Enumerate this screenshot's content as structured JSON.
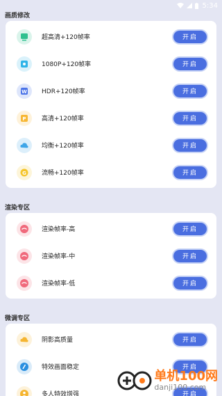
{
  "status_bar": {
    "time": "5:34"
  },
  "sections": [
    {
      "title": "画质修改",
      "items": [
        {
          "label": "超高清+120帧率",
          "button": "开启",
          "icon": "hd-monitor-icon",
          "color": "#2fc08f"
        },
        {
          "label": "1080P+120帧率",
          "button": "开启",
          "icon": "eye-icon",
          "color": "#2fb4e8"
        },
        {
          "label": "HDR+120帧率",
          "button": "开启",
          "icon": "w-letter-icon",
          "color": "#4a73e8"
        },
        {
          "label": "高清+120帧率",
          "button": "开启",
          "icon": "p-letter-icon",
          "color": "#f7b733"
        },
        {
          "label": "均衡+120帧率",
          "button": "开启",
          "icon": "cloud-icon",
          "color": "#3fa6e8"
        },
        {
          "label": "流畅+120帧率",
          "button": "开启",
          "icon": "g-letter-icon",
          "color": "#f5c52c"
        }
      ]
    },
    {
      "title": "渲染专区",
      "items": [
        {
          "label": "渲染帧率-高",
          "button": "开启",
          "icon": "render-icon",
          "color": "#f06a7c"
        },
        {
          "label": "渲染帧率-中",
          "button": "开启",
          "icon": "render-icon",
          "color": "#f06a7c"
        },
        {
          "label": "渲染帧率-低",
          "button": "开启",
          "icon": "render-icon",
          "color": "#f06a7c"
        }
      ]
    },
    {
      "title": "微调专区",
      "items": [
        {
          "label": "阴影高质量",
          "button": "开启",
          "icon": "cloud-icon",
          "color": "#f5b531"
        },
        {
          "label": "特效画面稳定",
          "button": "开启",
          "icon": "brush-icon",
          "color": "#2a8fe0"
        },
        {
          "label": "多人特效增强",
          "button": "开启",
          "icon": "people-icon",
          "color": "#f5b531"
        }
      ]
    }
  ],
  "watermark": {
    "line1": "单机100网",
    "line2": "danji100.com"
  },
  "colors": {
    "background": "#e4e6f3",
    "button": "#4a6ee0",
    "button_border": "#c7d3f6"
  }
}
